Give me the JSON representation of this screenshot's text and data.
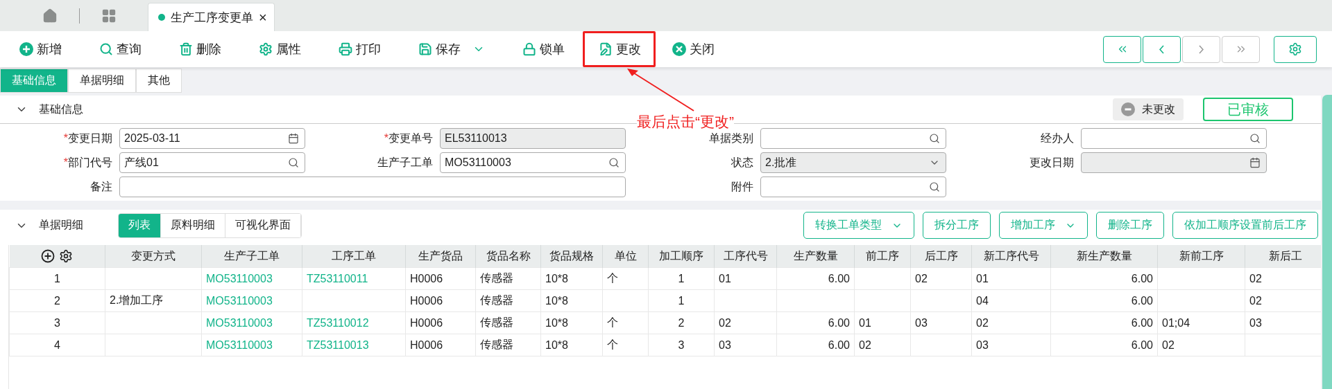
{
  "nav_tabs": [
    {
      "kind": "home"
    },
    {
      "kind": "grid"
    },
    {
      "kind": "doc",
      "label": "生产工序变更单",
      "close": "×",
      "selected": true
    }
  ],
  "toolbar": [
    {
      "kind": "add",
      "label": "新增",
      "highlighted": false
    },
    {
      "kind": "query",
      "label": "查询",
      "highlighted": false
    },
    {
      "kind": "delete",
      "label": "删除",
      "highlighted": false
    },
    {
      "kind": "properties",
      "label": "属性",
      "highlighted": false
    },
    {
      "kind": "print",
      "label": "打印",
      "highlighted": false
    },
    {
      "kind": "save",
      "label": "保存",
      "dropdown": true,
      "highlighted": false
    },
    {
      "kind": "lock",
      "label": "锁单",
      "highlighted": false
    },
    {
      "kind": "edit",
      "label": "更改",
      "highlighted": true
    },
    {
      "kind": "close",
      "label": "关闭",
      "highlighted": false
    }
  ],
  "pager": [
    {
      "kind": "first",
      "disabled": false
    },
    {
      "kind": "prev",
      "disabled": false
    },
    {
      "kind": "next",
      "disabled": true
    },
    {
      "kind": "last",
      "disabled": true
    }
  ],
  "section_tabs": [
    {
      "label": "基础信息",
      "selected": true
    },
    {
      "label": "单据明细",
      "selected": false
    },
    {
      "label": "其他",
      "selected": false
    }
  ],
  "basic": {
    "title": "基础信息",
    "change_status": "未更改",
    "audit_stamp": "已审核",
    "fields": [
      {
        "marker": "*",
        "label": "变更日期",
        "value": "2025-03-11",
        "kind": "date",
        "readonly": false
      },
      {
        "marker": "*",
        "label": "变更单号",
        "value": "EL53110013",
        "kind": "text",
        "readonly": true
      },
      {
        "label": "单据类别",
        "kind": "lookup",
        "readonly": false
      },
      {
        "label": "经办人",
        "kind": "lookup",
        "readonly": false
      },
      {
        "marker": "*",
        "label": "部门代号",
        "value": "产线01",
        "kind": "lookup",
        "readonly": false
      },
      {
        "label": "生产子工单",
        "value": "MO53110003",
        "kind": "lookup",
        "readonly": false
      },
      {
        "label": "状态",
        "value": "2.批准",
        "kind": "select",
        "readonly": true
      },
      {
        "label": "更改日期",
        "kind": "date",
        "readonly": true
      },
      {
        "label": "备注",
        "kind": "memo",
        "readonly": false
      },
      {
        "label": "附件",
        "kind": "lookup",
        "readonly": false
      }
    ]
  },
  "annotation": {
    "text": "最后点击“更改”"
  },
  "detail": {
    "title": "单据明细",
    "view_tabs": [
      {
        "label": "列表",
        "selected": true
      },
      {
        "label": "原料明细",
        "selected": false
      },
      {
        "label": "可视化界面",
        "selected": false
      }
    ],
    "actions": [
      {
        "label": "转换工单类型",
        "dropdown": true
      },
      {
        "label": "拆分工序",
        "dropdown": false
      },
      {
        "label": "增加工序",
        "dropdown": true
      },
      {
        "label": "删除工序",
        "dropdown": false
      },
      {
        "label": "依加工顺序设置前后工序",
        "dropdown": false
      }
    ],
    "table": {
      "columns": [
        {
          "kind": "index"
        },
        {
          "label": "变更方式",
          "kind": "text"
        },
        {
          "label": "生产子工单",
          "kind": "link"
        },
        {
          "label": "工序工单",
          "kind": "link"
        },
        {
          "label": "生产货品",
          "kind": "text"
        },
        {
          "label": "货品名称",
          "kind": "text"
        },
        {
          "label": "货品规格",
          "kind": "text"
        },
        {
          "label": "单位",
          "kind": "text"
        },
        {
          "label": "加工顺序",
          "kind": "center"
        },
        {
          "label": "工序代号",
          "kind": "text"
        },
        {
          "label": "生产数量",
          "kind": "number"
        },
        {
          "label": "前工序",
          "kind": "text"
        },
        {
          "label": "后工序",
          "kind": "text"
        },
        {
          "label": "新工序代号",
          "kind": "text"
        },
        {
          "label": "新生产数量",
          "kind": "number"
        },
        {
          "label": "新前工序",
          "kind": "text"
        },
        {
          "label": "新后工",
          "kind": "text"
        }
      ],
      "rows": [
        [
          "1",
          "",
          "MO53110003",
          "TZ53110011",
          "H0006",
          "传感器",
          "10*8",
          "个",
          "1",
          "01",
          "6.00",
          "",
          "02",
          "01",
          "6.00",
          "",
          "02"
        ],
        [
          "2",
          "2.增加工序",
          "MO53110003",
          "",
          "H0006",
          "传感器",
          "10*8",
          "",
          "1",
          "",
          "",
          "",
          "",
          "04",
          "6.00",
          "",
          "02"
        ],
        [
          "3",
          "",
          "MO53110003",
          "TZ53110012",
          "H0006",
          "传感器",
          "10*8",
          "个",
          "2",
          "02",
          "6.00",
          "01",
          "03",
          "02",
          "6.00",
          "01;04",
          "03"
        ],
        [
          "4",
          "",
          "MO53110003",
          "TZ53110013",
          "H0006",
          "传感器",
          "10*8",
          "个",
          "3",
          "03",
          "6.00",
          "02",
          "",
          "03",
          "6.00",
          "02",
          ""
        ]
      ]
    }
  }
}
